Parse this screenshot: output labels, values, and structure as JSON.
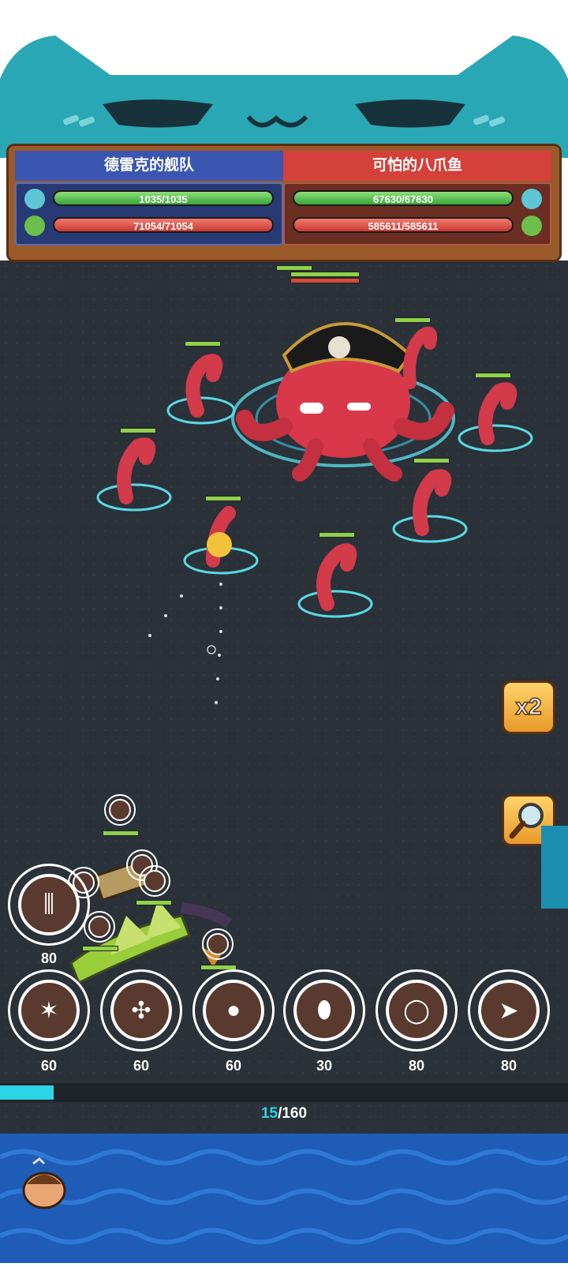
{
  "hud": {
    "left_team": "德雷克的舰队",
    "right_team": "可怕的八爪鱼",
    "left_crew_hp": "1035/1035",
    "left_ship_hp": "71054/71054",
    "right_crew_hp": "67630/67630",
    "right_ship_hp": "585611/585611"
  },
  "controls": {
    "speed_label": "x2",
    "zoom_icon": "magnifier-icon"
  },
  "skills": [
    {
      "cost": "80",
      "icon": "cannon-volley-icon"
    },
    {
      "cost": "60",
      "icon": "burst-icon"
    },
    {
      "cost": "60",
      "icon": "shield-icon"
    },
    {
      "cost": "60",
      "icon": "cannonball-icon"
    },
    {
      "cost": "30",
      "icon": "egg-icon"
    },
    {
      "cost": "80",
      "icon": "ring-icon"
    },
    {
      "cost": "80",
      "icon": "missile-icon"
    }
  ],
  "energy": {
    "current": "15",
    "max": "/160",
    "fill_fraction": 0.094
  },
  "colors": {
    "cat_teal": "#2aa7b4",
    "energy": "#2ad6e6"
  }
}
